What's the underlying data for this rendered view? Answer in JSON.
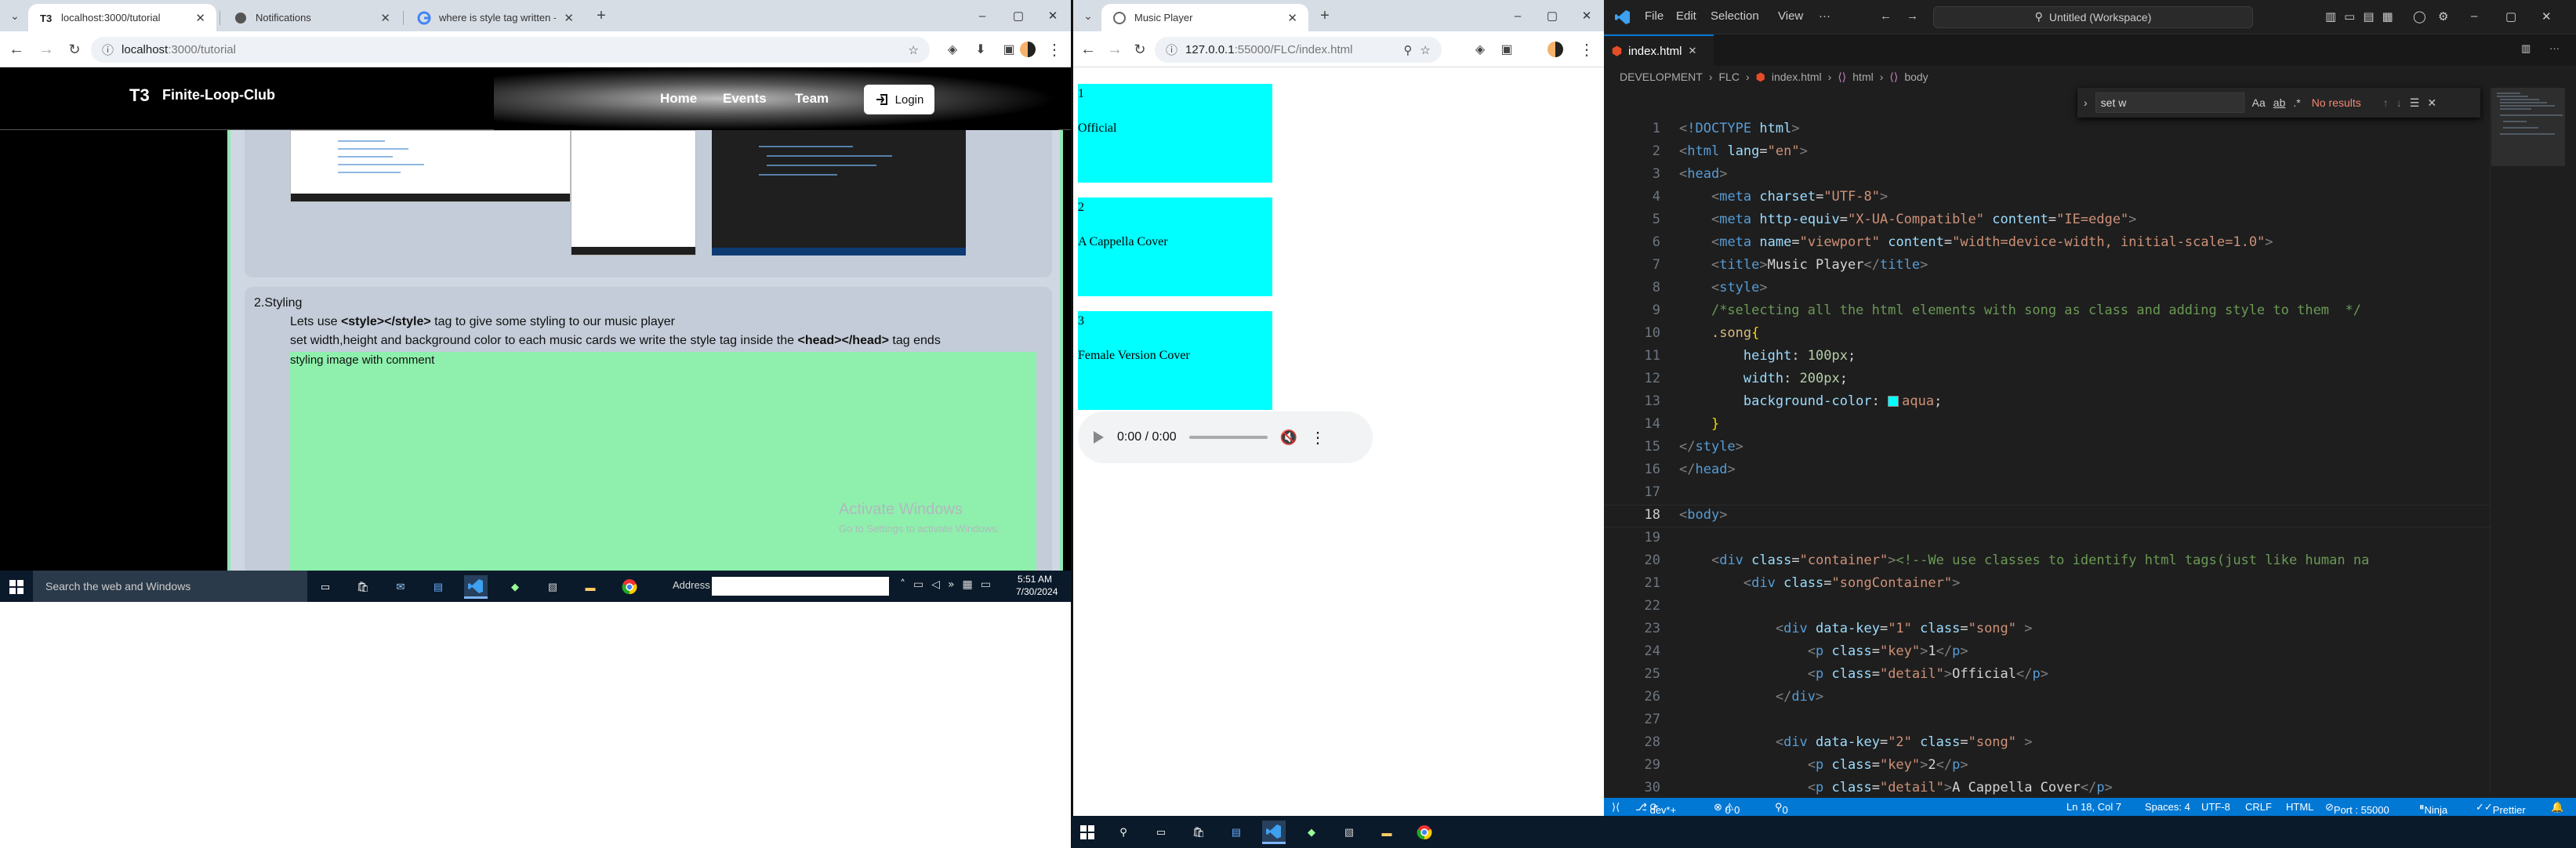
{
  "left_browser": {
    "tabs": [
      {
        "label": "localhost:3000/tutorial"
      },
      {
        "label": "Notifications"
      },
      {
        "label": "where is style tag written - Goo"
      }
    ],
    "url_host": "localhost",
    "url_rest": ":3000/tutorial",
    "site": {
      "brand": "Finite-Loop-Club",
      "nav": [
        "Home",
        "Events",
        "Team"
      ],
      "login": "Login",
      "section_title": "2.Styling",
      "line1_pre": "Lets use ",
      "line1_code": "<style></style>",
      "line1_post": " tag to give some styling to our music player",
      "line2_pre": "set width,height and background color to each music cards we write the style tag inside the ",
      "line2_code": "<head></head>",
      "line2_post": " tag ends",
      "caption": "styling image with comment",
      "watermark_title": "Activate Windows",
      "watermark_sub": "Go to Settings to activate Windows."
    },
    "taskbar": {
      "search_placeholder": "Search the web and Windows",
      "address_label": "Address",
      "time": "5:51 AM",
      "date": "7/30/2024"
    }
  },
  "middle_browser": {
    "tab": "Music Player",
    "url_host": "127.0.0.1",
    "url_rest": ":55000/FLC/index.html",
    "songs": [
      {
        "key": "1",
        "detail": "Official"
      },
      {
        "key": "2",
        "detail": "A Cappella Cover"
      },
      {
        "key": "3",
        "detail": "Female Version Cover"
      }
    ],
    "audio_time": "0:00 / 0:00"
  },
  "vscode": {
    "menu": [
      "File",
      "Edit",
      "Selection",
      "View",
      "···"
    ],
    "command_center": "Untitled (Workspace)",
    "tab": "index.html",
    "breadcrumb": [
      "DEVELOPMENT",
      "FLC",
      "index.html",
      "html",
      "body"
    ],
    "find_value": "set w",
    "find_result": "No results",
    "line_numbers": [
      "1",
      "2",
      "3",
      "4",
      "5",
      "6",
      "7",
      "8",
      "9",
      "10",
      "11",
      "12",
      "13",
      "14",
      "15",
      "16",
      "17",
      "18",
      "19",
      "20",
      "21",
      "22",
      "23",
      "24",
      "25",
      "26",
      "27",
      "28",
      "29",
      "30"
    ],
    "status": {
      "branch": "dev*+",
      "errors": "0",
      "warnings": "0",
      "ports": "0",
      "position": "Ln 18, Col 7",
      "spaces": "Spaces: 4",
      "encoding": "UTF-8",
      "eol": "CRLF",
      "language": "HTML",
      "port": "Port : 55000",
      "ninja": "Ninja",
      "prettier": "Prettier"
    }
  },
  "colors": {
    "aqua": "#00ffff",
    "vscode_blue": "#0078d4",
    "green_box": "#8ef0ac"
  }
}
